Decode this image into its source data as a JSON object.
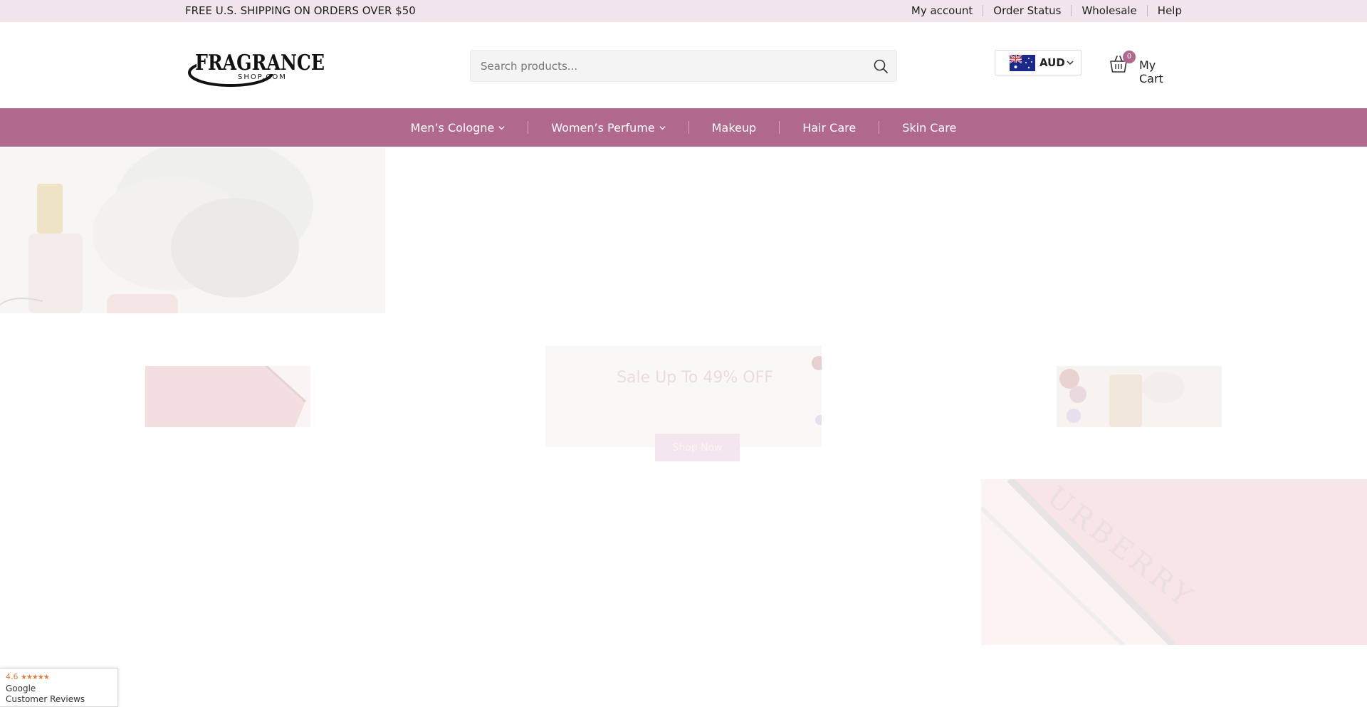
{
  "topbar": {
    "shipping_text": "FREE U.S. SHIPPING ON ORDERS OVER $50",
    "links": [
      "My account",
      "Order Status",
      "Wholesale",
      "Help"
    ]
  },
  "header": {
    "logo_text": "FRAGRANCE",
    "logo_subtext": "SHOP.COM",
    "search_placeholder": "Search products...",
    "currency_code": "AUD",
    "cart_count": "0",
    "cart_label": "My Cart"
  },
  "nav": {
    "items": [
      "Men’s Cologne",
      "Women’s Perfume",
      "Makeup",
      "Hair Care",
      "Skin Care"
    ]
  },
  "hero": {
    "banner_title": "Sale Up To 49% OFF",
    "shop_now": "Shop Now",
    "product_brand_text": "URBERRY"
  },
  "google_reviews": {
    "rating": "4.6",
    "stars": "★★★★★",
    "source": "Google",
    "label": "Customer Reviews"
  },
  "colors": {
    "topbar_bg": "#f1e4ec",
    "nav_bg": "#b0688c",
    "accent": "#b0688c"
  }
}
